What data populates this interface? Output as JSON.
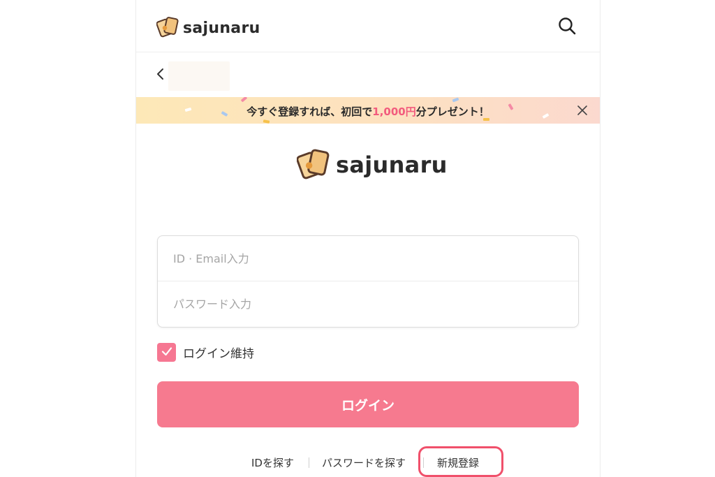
{
  "header": {
    "brand_name": "sajunaru",
    "search_icon": "search-icon",
    "back_icon": "chevron-left-icon"
  },
  "promo": {
    "text_before": "今すぐ登録すれば、初回で",
    "highlight": "1,000円",
    "text_after": "分プレゼント！",
    "highlight_color": "#f25b7d",
    "close_icon": "close-icon"
  },
  "logo": {
    "brand_name": "sajunaru"
  },
  "form": {
    "id_placeholder": "ID · Email入力",
    "password_placeholder": "パスワード入力",
    "keep_login_label": "ログイン維持",
    "keep_login_checked": true,
    "login_button": "ログイン"
  },
  "links": {
    "find_id": "IDを探す",
    "find_password": "パスワードを探す",
    "signup": "新規登録"
  },
  "colors": {
    "accent": "#f67a8f",
    "checkbox": "#f67792",
    "highlight_ring": "#f0506b"
  }
}
